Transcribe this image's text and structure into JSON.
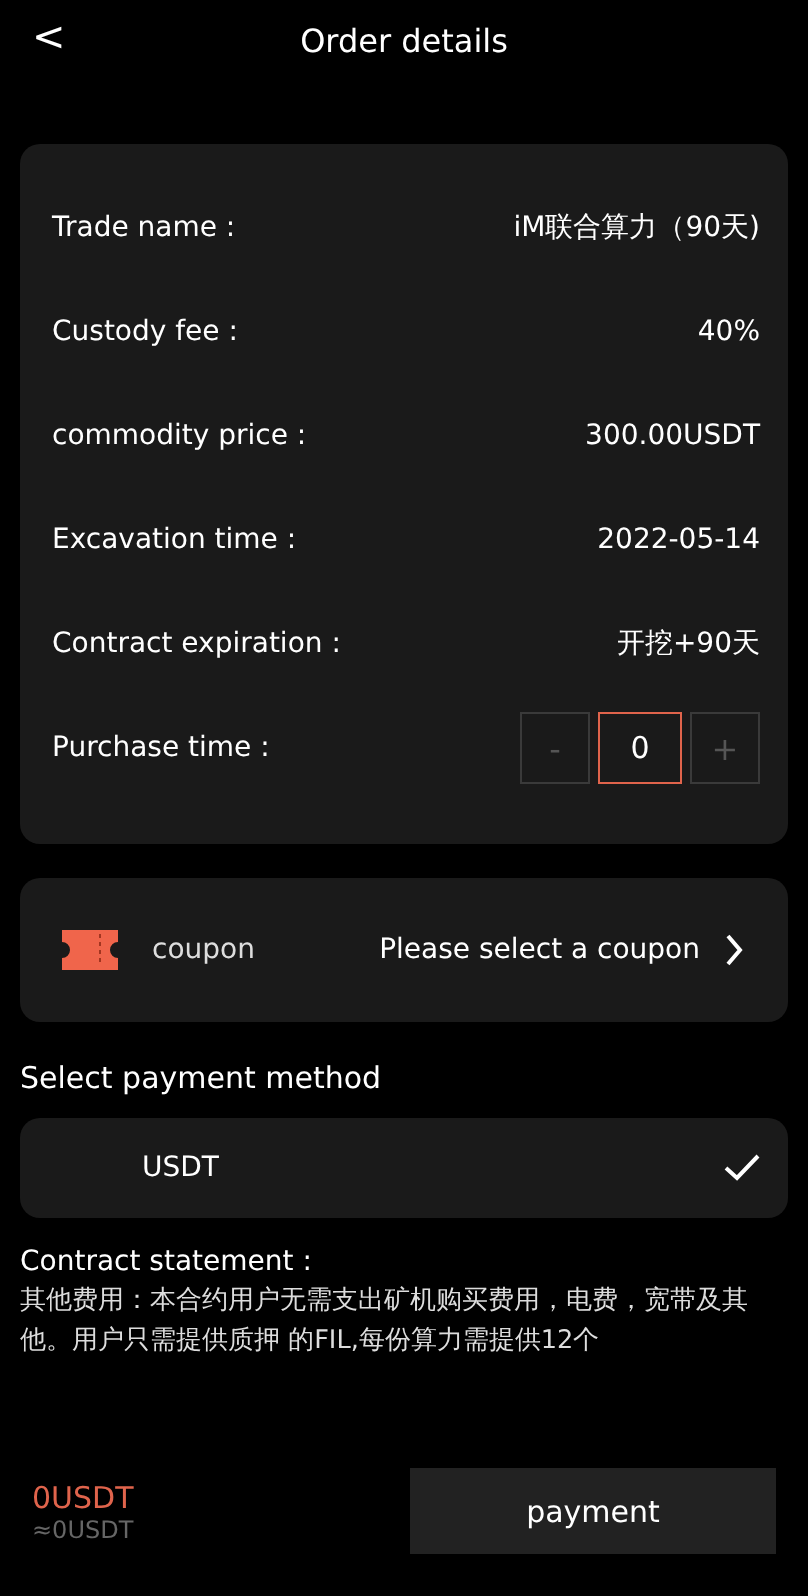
{
  "header": {
    "back": "<",
    "title": "Order details"
  },
  "details": [
    {
      "label": "Trade name :",
      "value": "iM联合算力（90天)"
    },
    {
      "label": "Custody fee :",
      "value": "40%"
    },
    {
      "label": "commodity price :",
      "value": "300.00USDT"
    },
    {
      "label": "Excavation time :",
      "value": "2022-05-14"
    },
    {
      "label": "Contract expiration :",
      "value": "开挖+90天"
    }
  ],
  "purchase": {
    "label": "Purchase time :",
    "minus": "-",
    "value": "0",
    "plus": "+",
    "minus_disabled": true,
    "plus_disabled": true
  },
  "coupon": {
    "label": "coupon",
    "value": "Please select a coupon"
  },
  "payment_heading": "Select payment method",
  "payment_methods": [
    {
      "name": "USDT",
      "selected": true
    }
  ],
  "statement": {
    "title": "Contract statement :",
    "text": "其他费用：本合约用户无需支出矿机购买费用，电费，宽带及其他。用户只需提供质押 的FIL,每份算力需提供12个"
  },
  "footer": {
    "total": "0USDT",
    "approx": "≈0USDT",
    "button": "payment"
  }
}
